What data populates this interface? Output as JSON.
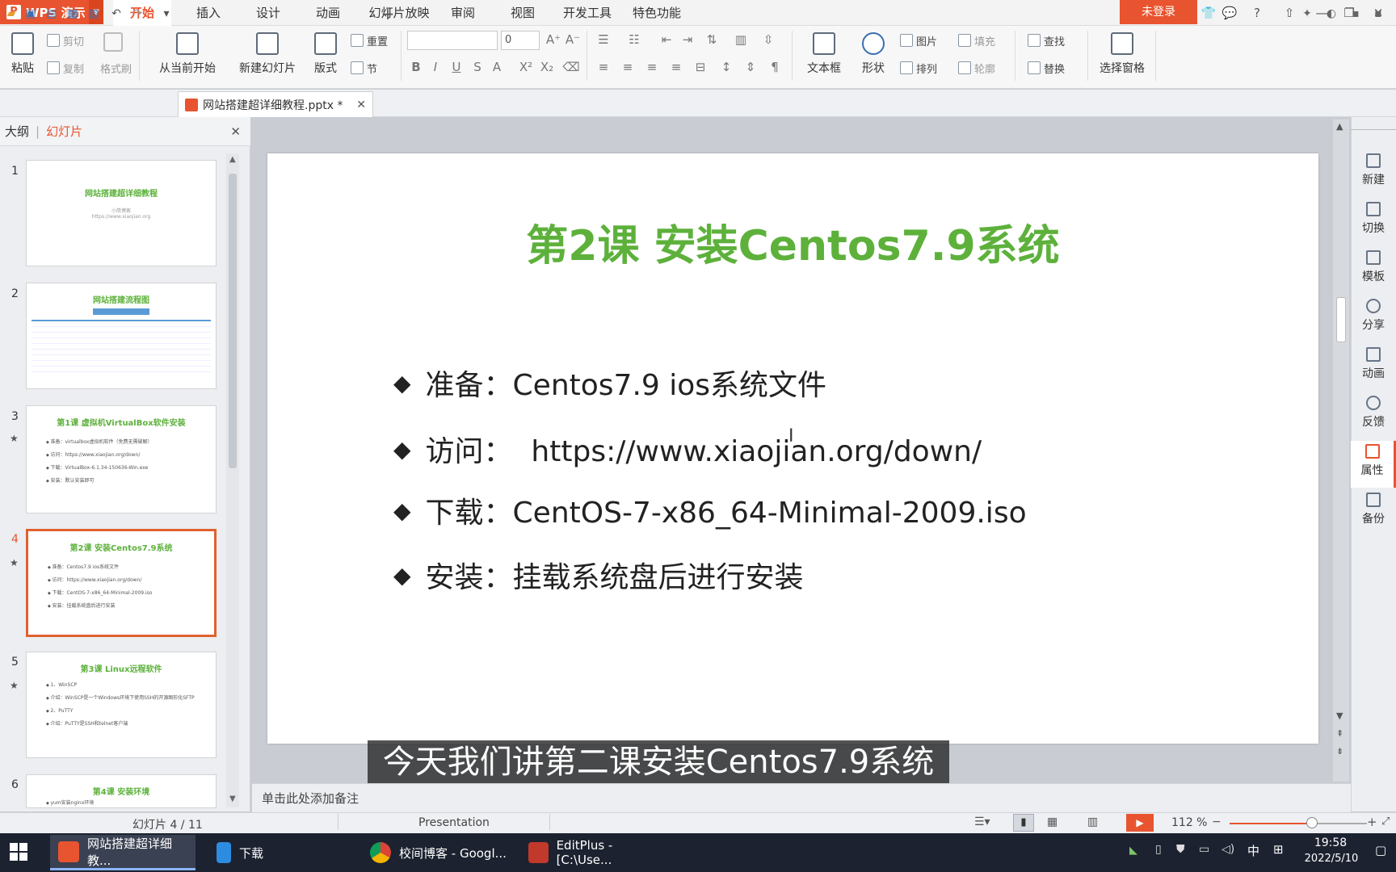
{
  "app": {
    "name": "WPS 演示",
    "login": "未登录"
  },
  "menu": [
    "开始",
    "插入",
    "设计",
    "动画",
    "幻灯片放映",
    "审阅",
    "视图",
    "开发工具",
    "特色功能"
  ],
  "ribbon": {
    "paste": "粘贴",
    "cut": "剪切",
    "copy": "复制",
    "format_painter": "格式刷",
    "from_current": "从当前开始",
    "new_slide": "新建幻灯片",
    "layout": "版式",
    "reset": "重置",
    "section": "节",
    "font_size": "0",
    "textbox": "文本框",
    "shape": "形状",
    "picture": "图片",
    "fill": "填充",
    "arrange": "排列",
    "outline": "轮廓",
    "find": "查找",
    "replace": "替换",
    "select_pane": "选择窗格"
  },
  "doc_tab": {
    "title": "网站搭建超详细教程.pptx *"
  },
  "panel": {
    "outline": "大纲",
    "slides": "幻灯片"
  },
  "thumbs": [
    {
      "num": "1",
      "title": "网站搭建超详细教程",
      "lines": [
        "小简博客",
        "https://www.xiaojian.org"
      ]
    },
    {
      "num": "2",
      "title": "网站搭建流程图",
      "lines": []
    },
    {
      "num": "3",
      "title": "第1课 虚拟机VirtualBox软件安装",
      "lines": [
        "准备：virtualbox虚拟机软件（免费无需破解）",
        "访问：https://www.xiaojian.org/down/",
        "下载：VirtualBox-6.1.34-150636-Win.exe",
        "安装：默认安装即可"
      ]
    },
    {
      "num": "4",
      "title": "第2课 安装Centos7.9系统",
      "lines": [
        "准备：Centos7.9 ios系统文件",
        "访问：https://www.xiaojian.org/down/",
        "下载：CentOS-7-x86_64-Minimal-2009.iso",
        "安装：挂载系统盘后进行安装"
      ]
    },
    {
      "num": "5",
      "title": "第3课 Linux远程软件",
      "lines": [
        "1、WinSCP",
        "介绍：WinSCP是一个Windows环境下使用SSH的开源图形化SFTP",
        "2、PuTTY",
        "介绍：PuTTY是SSH和telnet客户端"
      ]
    },
    {
      "num": "6",
      "title": "第4课 安装环境",
      "lines": [
        "yum安装nginx环境"
      ]
    }
  ],
  "slide": {
    "title": "第2课 安装Centos7.9系统",
    "bullets": [
      "准备：Centos7.9 ios系统文件",
      "访问：  https://www.xiaojian.org/down/",
      "下载：CentOS-7-x86_64-Minimal-2009.iso",
      "安装：挂载系统盘后进行安装"
    ]
  },
  "subtitle": "今天我们讲第二课安装Centos7.9系统",
  "notes_placeholder": "单击此处添加备注",
  "right_sidebar": [
    "新建",
    "切换",
    "模板",
    "分享",
    "动画",
    "反馈",
    "属性",
    "备份"
  ],
  "status": {
    "slide_count": "幻灯片 4 / 11",
    "theme": "Presentation",
    "zoom": "112 %",
    "zoom_level": 0.6
  },
  "taskbar": {
    "items": [
      "网站搭建超详细教...",
      "下载",
      "校间博客 - Googl...",
      "EditPlus - [C:\\Use..."
    ],
    "ime": "中",
    "time": "19:58",
    "date": "2022/5/10"
  },
  "colors": {
    "accent": "#e8542f",
    "slide_title": "#5db13b",
    "taskbar": "#1c2230"
  }
}
